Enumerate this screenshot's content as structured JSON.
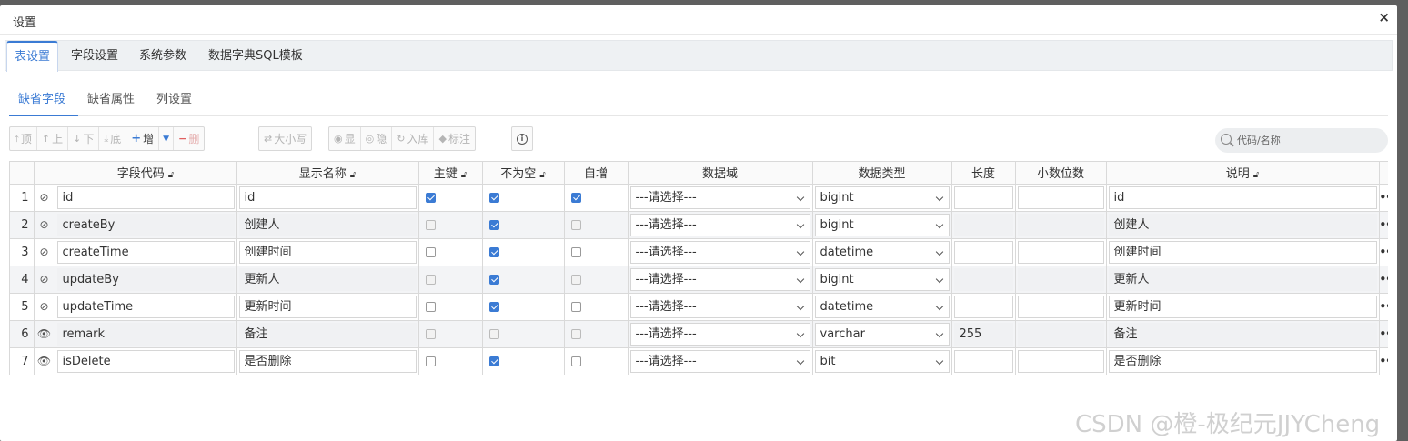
{
  "dialog": {
    "title": "设置",
    "close_glyph": "×"
  },
  "main_tabs": [
    {
      "label": "表设置",
      "active": true
    },
    {
      "label": "字段设置",
      "active": false
    },
    {
      "label": "系统参数",
      "active": false
    },
    {
      "label": "数据字典SQL模板",
      "active": false
    }
  ],
  "sub_tabs": [
    {
      "label": "缺省字段",
      "active": true
    },
    {
      "label": "缺省属性",
      "active": false
    },
    {
      "label": "列设置",
      "active": false
    }
  ],
  "toolbar": {
    "top": "顶",
    "up": "上",
    "down": "下",
    "bottom": "底",
    "add": "增",
    "delete": "删",
    "case": "大小写",
    "show": "显",
    "hide": "隐",
    "import": "入库",
    "annotate": "标注"
  },
  "search": {
    "placeholder": "代码/名称"
  },
  "columns": [
    "字段代码",
    "显示名称",
    "主键",
    "不为空",
    "自增",
    "数据域",
    "数据类型",
    "长度",
    "小数位数",
    "说明"
  ],
  "rows": [
    {
      "num": "1",
      "code": "id",
      "name": "id",
      "pk": true,
      "notnull": true,
      "autoinc": true,
      "domain": "---请选择---",
      "type": "bigint",
      "length": "",
      "scale": "",
      "comment": "id",
      "visible": false
    },
    {
      "num": "2",
      "code": "createBy",
      "name": "创建人",
      "pk": false,
      "notnull": true,
      "autoinc": false,
      "domain": "---请选择---",
      "type": "bigint",
      "length": "",
      "scale": "",
      "comment": "创建人",
      "visible": false
    },
    {
      "num": "3",
      "code": "createTime",
      "name": "创建时间",
      "pk": false,
      "notnull": true,
      "autoinc": false,
      "domain": "---请选择---",
      "type": "datetime",
      "length": "",
      "scale": "",
      "comment": "创建时间",
      "visible": false
    },
    {
      "num": "4",
      "code": "updateBy",
      "name": "更新人",
      "pk": false,
      "notnull": true,
      "autoinc": false,
      "domain": "---请选择---",
      "type": "bigint",
      "length": "",
      "scale": "",
      "comment": "更新人",
      "visible": false
    },
    {
      "num": "5",
      "code": "updateTime",
      "name": "更新时间",
      "pk": false,
      "notnull": true,
      "autoinc": false,
      "domain": "---请选择---",
      "type": "datetime",
      "length": "",
      "scale": "",
      "comment": "更新时间",
      "visible": false
    },
    {
      "num": "6",
      "code": "remark",
      "name": "备注",
      "pk": false,
      "notnull": false,
      "autoinc": false,
      "domain": "---请选择---",
      "type": "varchar",
      "length": "255",
      "scale": "",
      "comment": "备注",
      "visible": true
    },
    {
      "num": "7",
      "code": "isDelete",
      "name": "是否删除",
      "pk": false,
      "notnull": true,
      "autoinc": false,
      "domain": "---请选择---",
      "type": "bit",
      "length": "",
      "scale": "",
      "comment": "是否删除",
      "visible": true
    }
  ],
  "more_glyph": "•••",
  "watermark": "CSDN @橙-极纪元JJYCheng",
  "colors": {
    "accent": "#3b7bd4",
    "overlay": "#5f5f5f"
  }
}
